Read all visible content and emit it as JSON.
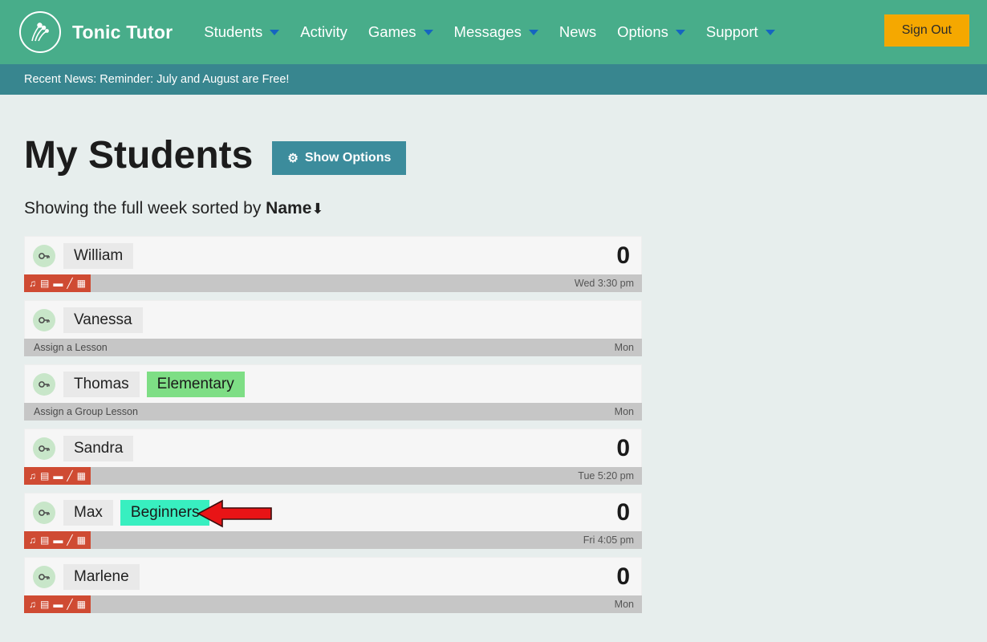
{
  "navbar": {
    "logo_icon": "tonic-tutor-logo-icon",
    "brand": "Tonic Tutor",
    "items": [
      {
        "label": "Students",
        "has_caret": true
      },
      {
        "label": "Activity",
        "has_caret": false
      },
      {
        "label": "Games",
        "has_caret": true
      },
      {
        "label": "Messages",
        "has_caret": true
      },
      {
        "label": "News",
        "has_caret": false
      },
      {
        "label": "Options",
        "has_caret": true
      },
      {
        "label": "Support",
        "has_caret": true
      }
    ],
    "sign_out": "Sign Out",
    "bg_color": "#48ad8a",
    "signout_color": "#f5a800"
  },
  "newsbar": {
    "text": "Recent News: Reminder: July and August are Free!",
    "bg_color": "#38868f"
  },
  "page": {
    "title": "My Students",
    "show_options_label": "Show Options",
    "show_options_icon": "gear-icon",
    "subtitle_prefix": "Showing the full week sorted by ",
    "subtitle_sort_field": "Name",
    "subtitle_sort_arrow": "⬇",
    "bg_color": "#e7eeed"
  },
  "students": [
    {
      "avatar_icon": "key-icon",
      "name": "William",
      "group": null,
      "group_color": null,
      "count": "0",
      "assign_text": null,
      "has_icon_bar": true,
      "time": "Wed 3:30 pm",
      "annotated": false
    },
    {
      "avatar_icon": "key-icon",
      "name": "Vanessa",
      "group": null,
      "group_color": null,
      "count": null,
      "assign_text": "Assign a Lesson",
      "has_icon_bar": false,
      "time": "Mon",
      "annotated": false
    },
    {
      "avatar_icon": "key-icon",
      "name": "Thomas",
      "group": "Elementary",
      "group_color": "#7ede85",
      "count": null,
      "assign_text": "Assign a Group Lesson",
      "has_icon_bar": false,
      "time": "Mon",
      "annotated": false
    },
    {
      "avatar_icon": "key-icon",
      "name": "Sandra",
      "group": null,
      "group_color": null,
      "count": "0",
      "assign_text": null,
      "has_icon_bar": true,
      "time": "Tue 5:20 pm",
      "annotated": false
    },
    {
      "avatar_icon": "key-icon",
      "name": "Max",
      "group": "Beginners",
      "group_color": "#38efc0",
      "count": "0",
      "assign_text": null,
      "has_icon_bar": true,
      "time": "Fri 4:05 pm",
      "annotated": true
    },
    {
      "avatar_icon": "key-icon",
      "name": "Marlene",
      "group": null,
      "group_color": null,
      "count": "0",
      "assign_text": null,
      "has_icon_bar": true,
      "time": "Mon",
      "annotated": false
    }
  ],
  "row_icons": [
    {
      "name": "music-note-icon",
      "glyph": "♫"
    },
    {
      "name": "book-icon",
      "glyph": "▤"
    },
    {
      "name": "comment-icon",
      "glyph": "▬"
    },
    {
      "name": "pencil-icon",
      "glyph": "╱"
    },
    {
      "name": "calendar-icon",
      "glyph": "▦"
    }
  ],
  "annotation": {
    "type": "arrow-pointing-left",
    "color": "#e81416",
    "target": "Beginners"
  }
}
